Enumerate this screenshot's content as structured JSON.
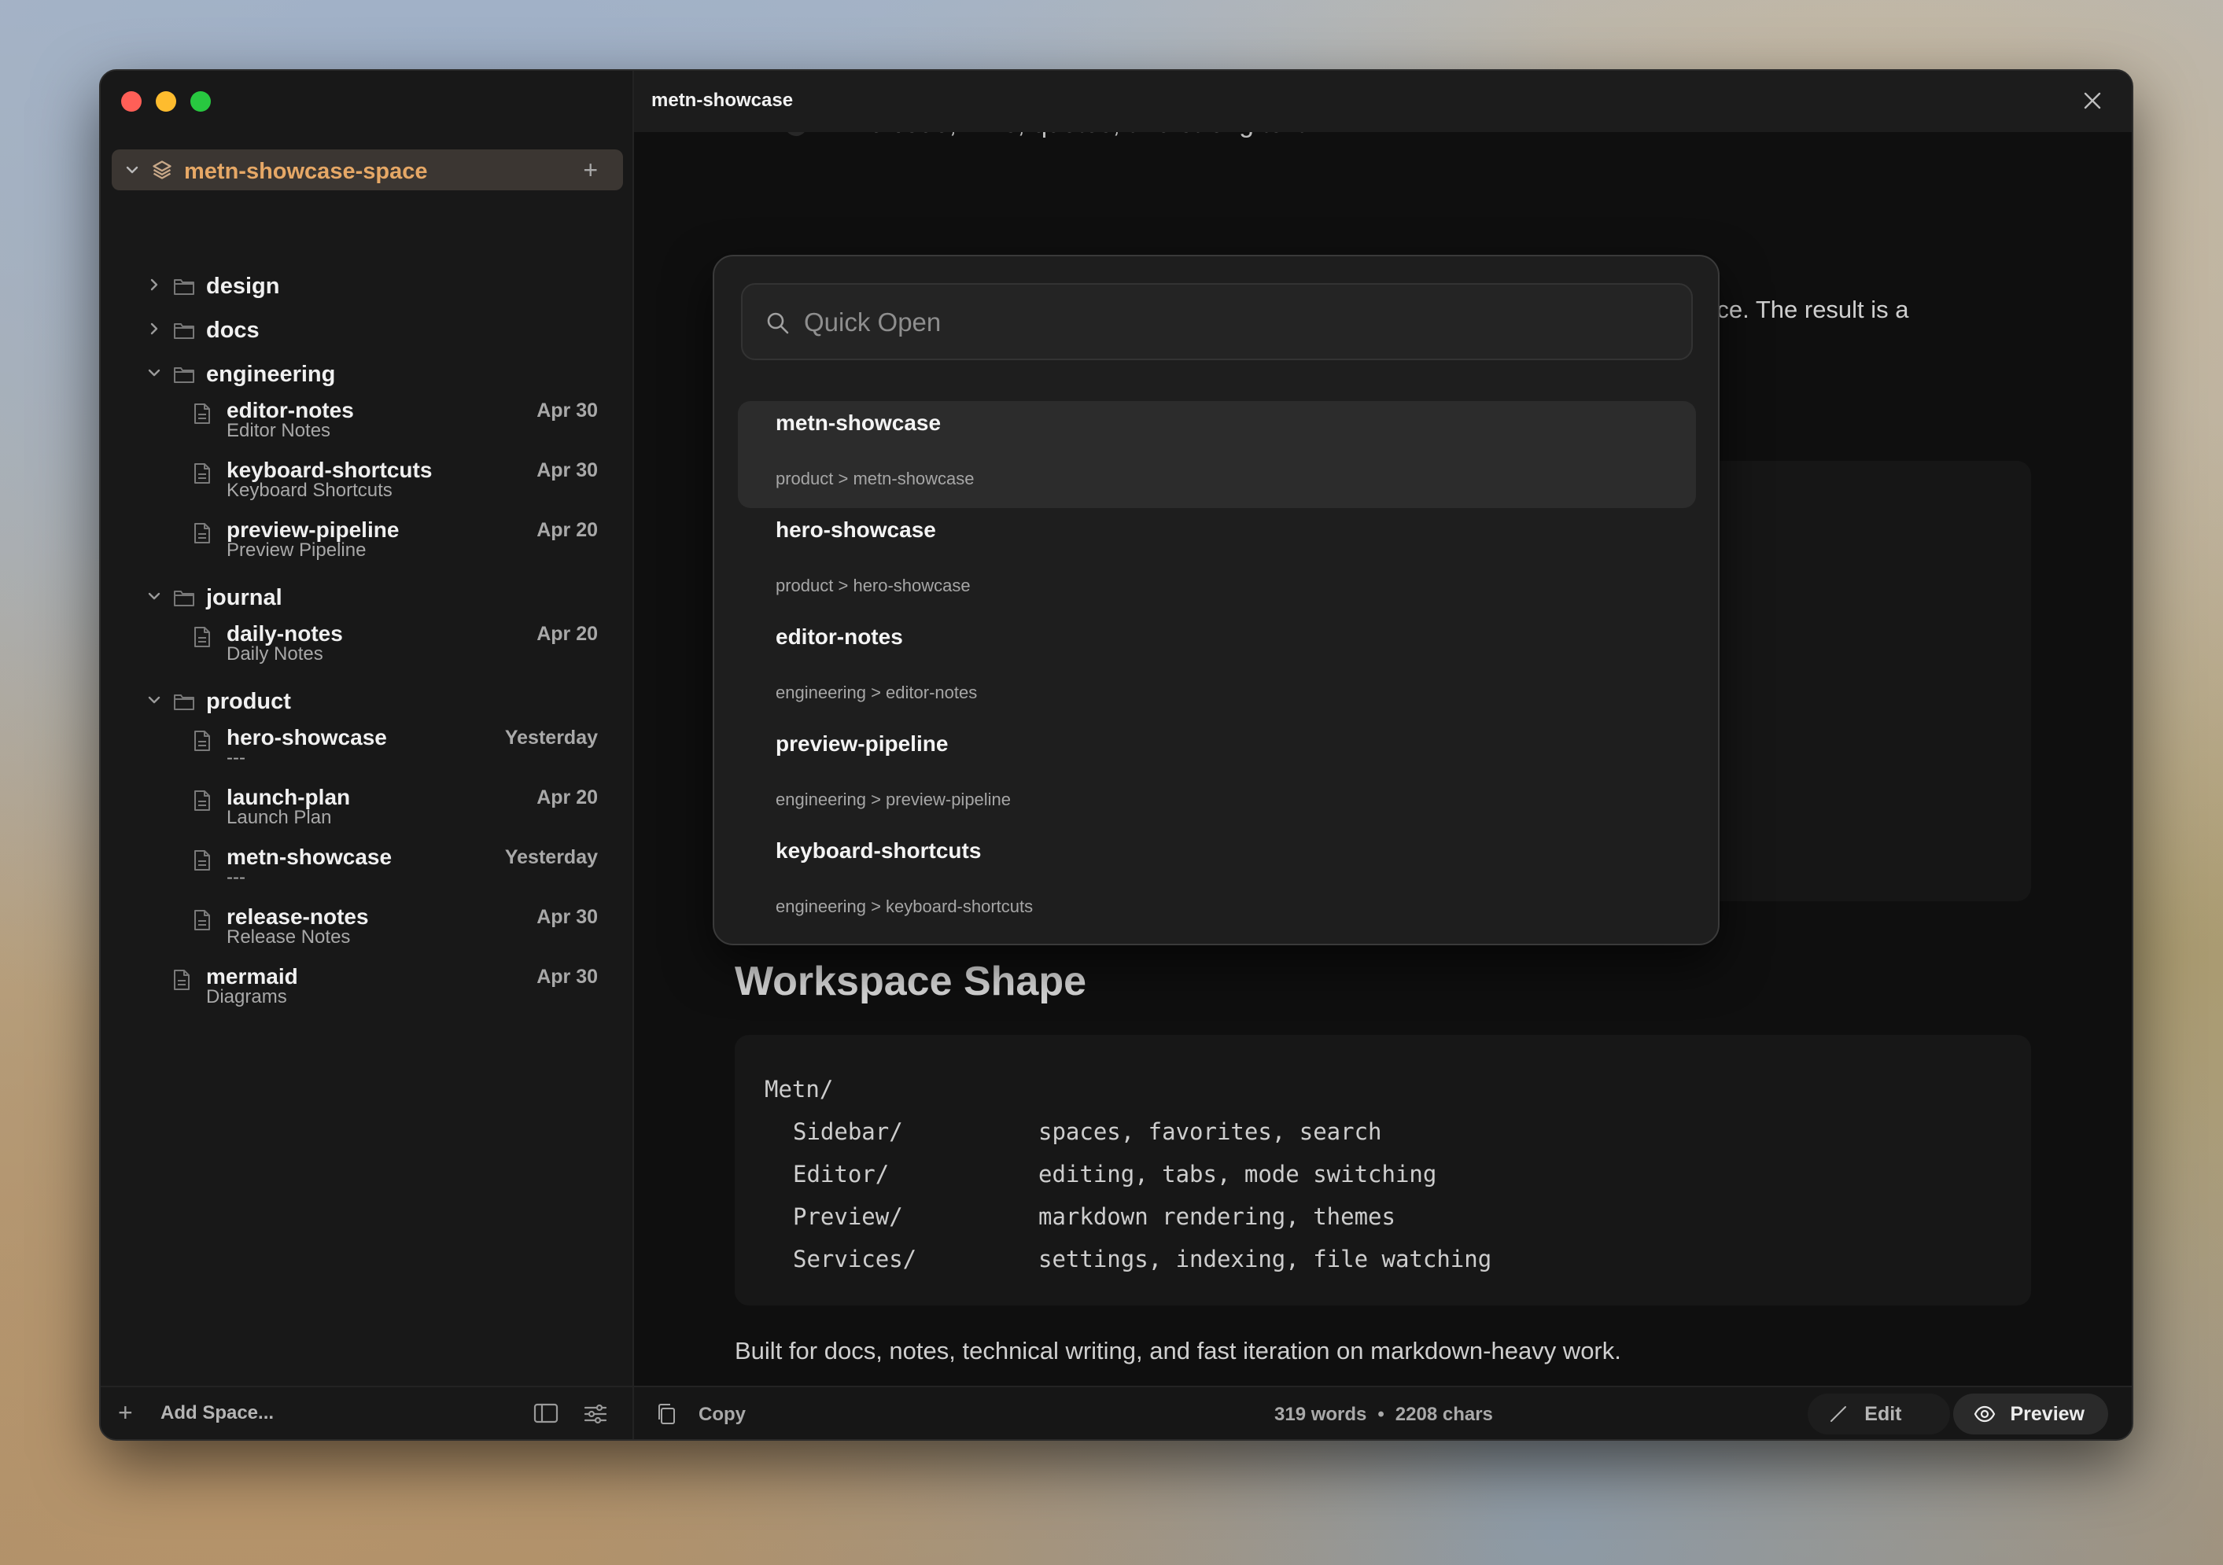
{
  "sidebar": {
    "space": {
      "name": "metn-showcase-space"
    },
    "tree": [
      {
        "type": "folder",
        "name": "design",
        "expanded": false
      },
      {
        "type": "folder",
        "name": "docs",
        "expanded": false
      },
      {
        "type": "folder",
        "name": "engineering",
        "expanded": true
      },
      {
        "type": "file",
        "name": "editor-notes",
        "subtitle": "Editor Notes",
        "date": "Apr 30"
      },
      {
        "type": "file",
        "name": "keyboard-shortcuts",
        "subtitle": "Keyboard Shortcuts",
        "date": "Apr 30"
      },
      {
        "type": "file",
        "name": "preview-pipeline",
        "subtitle": "Preview Pipeline",
        "date": "Apr 20"
      },
      {
        "type": "folder",
        "name": "journal",
        "expanded": true
      },
      {
        "type": "file",
        "name": "daily-notes",
        "subtitle": "Daily Notes",
        "date": "Apr 20"
      },
      {
        "type": "folder",
        "name": "product",
        "expanded": true
      },
      {
        "type": "file",
        "name": "hero-showcase",
        "subtitle": "---",
        "date": "Yesterday"
      },
      {
        "type": "file",
        "name": "launch-plan",
        "subtitle": "Launch Plan",
        "date": "Apr 20"
      },
      {
        "type": "file",
        "name": "metn-showcase",
        "subtitle": "---",
        "date": "Yesterday"
      },
      {
        "type": "file",
        "name": "release-notes",
        "subtitle": "Release Notes",
        "date": "Apr 30"
      },
      {
        "type": "file",
        "name": "mermaid",
        "subtitle": "Diagrams",
        "date": "Apr 30"
      }
    ],
    "footer": {
      "add_space_label": "Add Space..."
    }
  },
  "main": {
    "title": "metn-showcase",
    "cut_bullet": "inline code, links, quotes, and strong text",
    "paragraph1": "g the raw source. The result is a",
    "heading": "Workspace Shape",
    "code": {
      "root": "Metn/",
      "rows": [
        {
          "key": "Sidebar/",
          "value": "spaces, favorites, search"
        },
        {
          "key": "Editor/",
          "value": "editing, tabs, mode switching"
        },
        {
          "key": "Preview/",
          "value": "markdown rendering, themes"
        },
        {
          "key": "Services/",
          "value": "settings, indexing, file watching"
        }
      ]
    },
    "paragraph2": "Built for docs, notes, technical writing, and fast iteration on markdown-heavy work."
  },
  "statusbar": {
    "copy_label": "Copy",
    "words": "319 words",
    "separator": "•",
    "chars": "2208 chars",
    "edit_label": "Edit",
    "preview_label": "Preview",
    "active_mode": "Preview"
  },
  "quick_open": {
    "placeholder": "Quick Open",
    "value": "",
    "results": [
      {
        "title": "metn-showcase",
        "path": "product > metn-showcase",
        "selected": true
      },
      {
        "title": "hero-showcase",
        "path": "product > hero-showcase",
        "selected": false
      },
      {
        "title": "editor-notes",
        "path": "engineering > editor-notes",
        "selected": false
      },
      {
        "title": "preview-pipeline",
        "path": "engineering > preview-pipeline",
        "selected": false
      },
      {
        "title": "keyboard-shortcuts",
        "path": "engineering > keyboard-shortcuts",
        "selected": false
      }
    ]
  },
  "colors": {
    "accent": "#e6a866",
    "window_bg": "#111111",
    "sidebar_bg": "#181818",
    "selected_space_bg": "#3b3632"
  }
}
